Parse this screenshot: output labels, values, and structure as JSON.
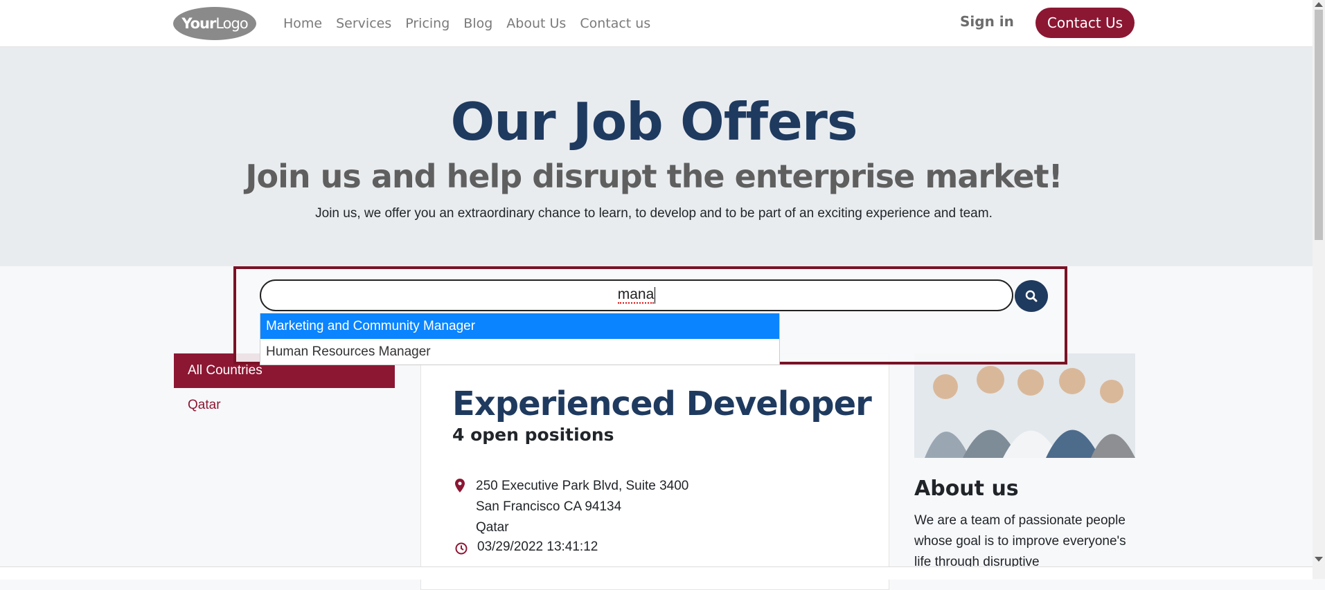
{
  "header": {
    "logo_text": "Your Logo",
    "nav": [
      "Home",
      "Services",
      "Pricing",
      "Blog",
      "About Us",
      "Contact us"
    ],
    "sign_in": "Sign in",
    "contact_button": "Contact Us"
  },
  "hero": {
    "title": "Our Job Offers",
    "subtitle": "Join us and help disrupt the enterprise market!",
    "description": "Join us, we offer you an extraordinary chance to learn, to develop and to be part of an exciting experience and team."
  },
  "search": {
    "value": "mana",
    "suggestions": [
      "Marketing and Community Manager",
      "Human Resources Manager"
    ]
  },
  "filters": {
    "active": "All Countries",
    "items": [
      "Qatar"
    ]
  },
  "job": {
    "title": "Experienced Developer",
    "positions": "4 open positions",
    "address_line1": "250 Executive Park Blvd, Suite 3400",
    "address_line2": "San Francisco CA 94134",
    "address_line3": "Qatar",
    "date": "03/29/2022 13:41:12"
  },
  "about": {
    "title": "About us",
    "text": "We are a team of passionate people whose goal is to improve everyone's life through disruptive"
  },
  "colors": {
    "brand": "#8c1733",
    "navy": "#1f3a5f",
    "highlight": "#0a84ff"
  }
}
